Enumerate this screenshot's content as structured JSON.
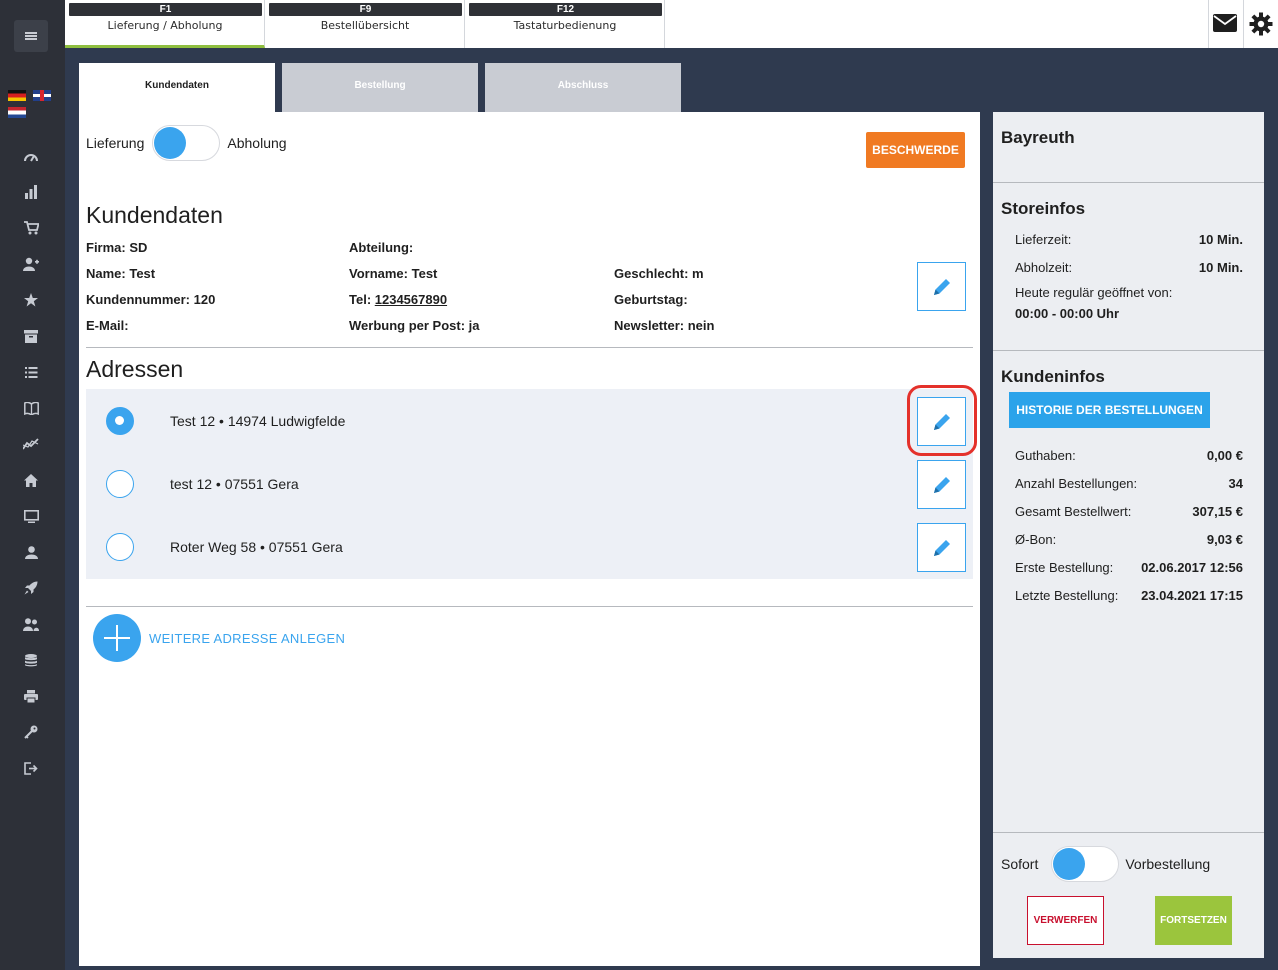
{
  "top_tabs": [
    {
      "key": "F1",
      "label": "Lieferung / Abholung"
    },
    {
      "key": "F9",
      "label": "Bestellübersicht"
    },
    {
      "key": "F12",
      "label": "Tastaturbedienung"
    }
  ],
  "sub_tabs": [
    "Kundendaten",
    "Bestellung",
    "Abschluss"
  ],
  "delivery_toggle": {
    "left": "Lieferung",
    "right": "Abholung"
  },
  "complaint_button": "BESCHWERDE",
  "customer": {
    "title": "Kundendaten",
    "firma": "Firma: SD",
    "abteilung": "Abteilung:",
    "name": "Name: Test",
    "vorname": "Vorname: Test",
    "geschlecht": "Geschlecht: m",
    "kundennummer": "Kundennummer: 120",
    "tel_label": "Tel: ",
    "tel_value": "1234567890",
    "geburtstag": "Geburtstag:",
    "email": "E-Mail:",
    "werbung": "Werbung per Post: ja",
    "newsletter": "Newsletter: nein"
  },
  "addresses": {
    "title": "Adressen",
    "items": [
      {
        "text": "Test 12 • 14974 Ludwigfelde",
        "selected": true
      },
      {
        "text": "test 12 • 07551 Gera",
        "selected": false
      },
      {
        "text": "Roter Weg 58 • 07551 Gera",
        "selected": false
      }
    ],
    "add_label": "WEITERE ADRESSE ANLEGEN"
  },
  "right_panel": {
    "store": "Bayreuth",
    "storeinfos_title": "Storeinfos",
    "lieferzeit_label": "Lieferzeit:",
    "lieferzeit_value": "10 Min.",
    "abholzeit_label": "Abholzeit:",
    "abholzeit_value": "10 Min.",
    "hours_label": "Heute regulär geöffnet von:",
    "hours_value": "00:00 - 00:00 Uhr",
    "kundeninfos_title": "Kundeninfos",
    "history_button": "HISTORIE DER BESTELLUNGEN",
    "stats": [
      {
        "label": "Guthaben:",
        "value": "0,00 €"
      },
      {
        "label": "Anzahl Bestellungen:",
        "value": "34"
      },
      {
        "label": "Gesamt Bestellwert:",
        "value": "307,15 €"
      },
      {
        "label": "Ø-Bon:",
        "value": "9,03 €"
      },
      {
        "label": "Erste Bestellung:",
        "value": "02.06.2017 12:56"
      },
      {
        "label": "Letzte Bestellung:",
        "value": "23.04.2021 17:15"
      }
    ],
    "order_toggle": {
      "left": "Sofort",
      "right": "Vorbestellung"
    },
    "discard_button": "VERWERFEN",
    "continue_button": "FORTSETZEN"
  },
  "icons": {
    "sidebar": [
      "gauge-icon",
      "bar-chart-icon",
      "cart-icon",
      "add-user-icon",
      "star-icon",
      "archive-icon",
      "list-icon",
      "book-icon",
      "trend-icon",
      "home-icon",
      "monitor-icon",
      "user-icon",
      "rocket-icon",
      "users-icon",
      "database-icon",
      "printer-icon",
      "key-icon",
      "logout-icon"
    ]
  },
  "colors": {
    "accent": "#3aa4ee",
    "complaint": "#f07a22",
    "continue": "#9bc53d",
    "discard": "#c8102e",
    "highlight": "#e4312b"
  }
}
